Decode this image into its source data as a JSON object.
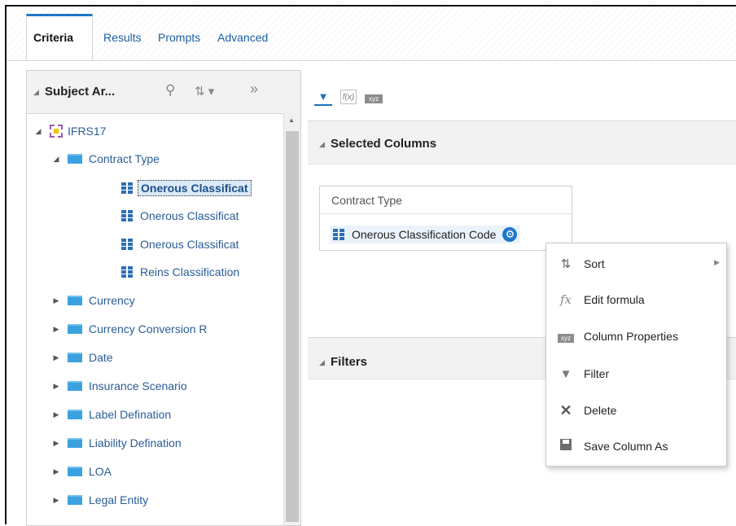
{
  "tabs": [
    {
      "label": "Criteria",
      "active": true
    },
    {
      "label": "Results",
      "active": false
    },
    {
      "label": "Prompts",
      "active": false
    },
    {
      "label": "Advanced",
      "active": false
    }
  ],
  "subject_area": {
    "title": "Subject Ar...",
    "icons": [
      "search-icon",
      "sort-icon",
      "expand-panel-icon"
    ],
    "tree": [
      {
        "label": "IFRS17",
        "type": "subject",
        "expanded": true
      },
      {
        "label": "Contract Type",
        "type": "folder",
        "expanded": true
      },
      {
        "label": "Onerous Classificat",
        "type": "column",
        "selected": true
      },
      {
        "label": "Onerous Classificat",
        "type": "column"
      },
      {
        "label": "Onerous Classificat",
        "type": "column"
      },
      {
        "label": "Reins Classification",
        "type": "column"
      },
      {
        "label": "Currency",
        "type": "folder",
        "expanded": false
      },
      {
        "label": "Currency Conversion R",
        "type": "folder",
        "expanded": false
      },
      {
        "label": "Date",
        "type": "folder",
        "expanded": false
      },
      {
        "label": "Insurance Scenario",
        "type": "folder",
        "expanded": false
      },
      {
        "label": "Label Defination",
        "type": "folder",
        "expanded": false
      },
      {
        "label": "Liability Defination",
        "type": "folder",
        "expanded": false
      },
      {
        "label": "LOA",
        "type": "folder",
        "expanded": false
      },
      {
        "label": "Legal Entity",
        "type": "folder",
        "expanded": false
      }
    ]
  },
  "toolbar": {
    "buttons": [
      "filter-icon",
      "formula-icon",
      "column-properties-icon"
    ],
    "xyz_text": "xyz"
  },
  "selected_columns": {
    "title": "Selected Columns",
    "card_header": "Contract Type",
    "column": "Onerous Classification Code"
  },
  "filters": {
    "title": "Filters"
  },
  "context_menu": {
    "items": [
      {
        "label": "Sort",
        "icon": "sort-icon",
        "has_submenu": true
      },
      {
        "label": "Edit formula",
        "icon": "fx-icon"
      },
      {
        "label": "Column Properties",
        "icon": "column-properties-icon"
      },
      {
        "label": "Filter",
        "icon": "filter-icon"
      },
      {
        "label": "Delete",
        "icon": "delete-icon"
      },
      {
        "label": "Save Column As",
        "icon": "save-icon"
      }
    ]
  },
  "colors": {
    "accent": "#1e78c8",
    "folder": "#3ba2e0",
    "link": "#2a5d95"
  }
}
